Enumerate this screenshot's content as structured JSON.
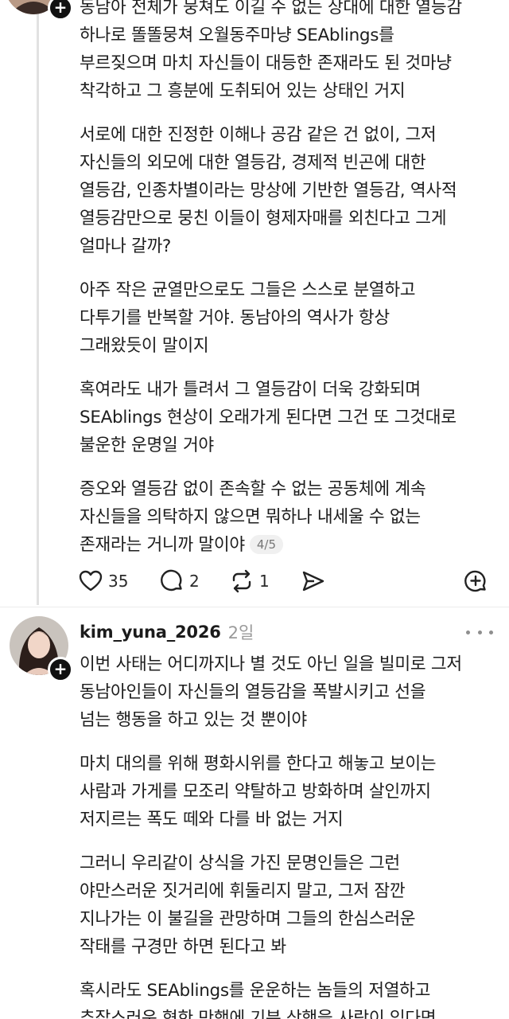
{
  "post1": {
    "paragraphs": [
      "동남아 전체가 뭉쳐도 이길 수 없는 상대에 대한 열등감\n하나로 똘똘뭉쳐 오월동주마냥 SEAblings를\n부르짖으며 마치 자신들이 대등한 존재라도 된 것마냥\n착각하고 그 흥분에 도취되어 있는 상태인 거지",
      "서로에 대한 진정한 이해나 공감 같은 건 없이, 그저\n자신들의 외모에 대한 열등감, 경제적 빈곤에 대한\n열등감, 인종차별이라는 망상에 기반한 열등감, 역사적\n열등감만으로 뭉친 이들이 형제자매를 외친다고 그게\n얼마나 갈까?",
      "아주 작은 균열만으로도 그들은 스스로 분열하고\n다투기를 반복할 거야. 동남아의 역사가 항상\n그래왔듯이 말이지",
      "혹여라도 내가 틀려서 그 열등감이 더욱 강화되며\nSEAblings 현상이 오래가게 된다면 그건 또 그것대로\n불운한 운명일 거야",
      "증오와 열등감 없이 존속할 수 없는 공동체에 계속\n자신들을 의탁하지 않으면 뭐하나 내세울 수 없는\n존재라는 거니까 말이야"
    ],
    "page_indicator": "4/5",
    "likes": "35",
    "replies": "2",
    "reposts": "1"
  },
  "post2": {
    "username": "kim_yuna_2026",
    "timestamp": "2일",
    "paragraphs": [
      "이번 사태는 어디까지나 별 것도 아닌 일을 빌미로 그저\n동남아인들이 자신들의 열등감을 폭발시키고 선을\n넘는 행동을 하고 있는 것 뿐이야",
      "마치 대의를 위해 평화시위를 한다고 해놓고 보이는\n사람과 가게를 모조리 약탈하고 방화하며 살인까지\n저지르는 폭도 떼와 다를 바 없는 거지",
      "그러니 우리같이 상식을 가진 문명인들은 그런\n야만스러운 짓거리에 휘둘리지 말고, 그저 잠깐\n지나가는 이 불길을 관망하며 그들의 한심스러운\n작태를 구경만 하면 된다고 봐",
      "혹시라도 SEAblings를 운운하는 놈들의 저열하고\n추잡스러운 혐한 만행에 기분 상했을 사람이 있다면"
    ]
  },
  "icons": {
    "like": "heart-icon",
    "reply": "comment-icon",
    "repost": "repost-icon",
    "share": "send-icon",
    "quote": "add-quote-icon",
    "more": "more-icon",
    "follow": "plus-icon"
  }
}
